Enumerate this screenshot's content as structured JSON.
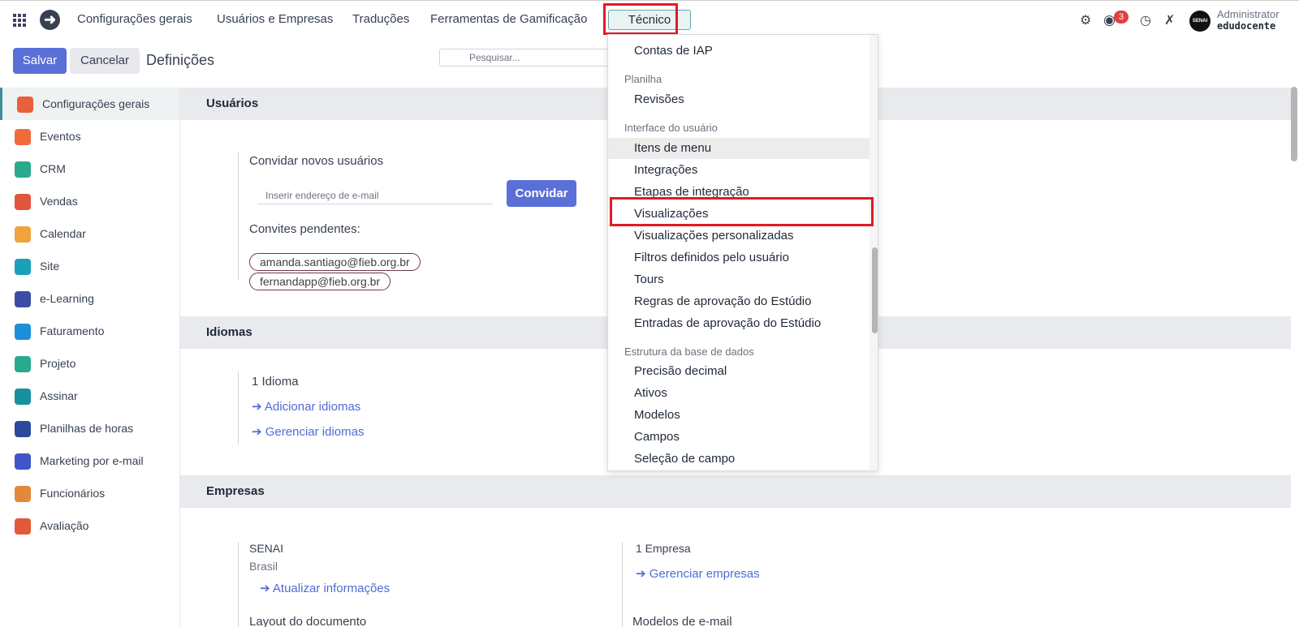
{
  "navbar": {
    "menu": [
      "Configurações gerais",
      "Usuários e Empresas",
      "Traduções",
      "Ferramentas de Gamificação"
    ],
    "active_menu": "Técnico",
    "notification_count": "3",
    "user": "Administrator",
    "database": "edudocente",
    "avatar_text": "SENAI"
  },
  "control": {
    "save": "Salvar",
    "cancel": "Cancelar",
    "title": "Definições",
    "search_placeholder": "Pesquisar..."
  },
  "sidebar": {
    "items": [
      {
        "label": "Configurações gerais",
        "icon": "settings-app-icon",
        "color": "#e8603c"
      },
      {
        "label": "Eventos",
        "icon": "events-app-icon",
        "color": "#f06b3c"
      },
      {
        "label": "CRM",
        "icon": "crm-app-icon",
        "color": "#2aa98e"
      },
      {
        "label": "Vendas",
        "icon": "sales-app-icon",
        "color": "#e1563c"
      },
      {
        "label": "Calendar",
        "icon": "calendar-app-icon",
        "color": "#f0a23c"
      },
      {
        "label": "Site",
        "icon": "website-app-icon",
        "color": "#1aa1b9"
      },
      {
        "label": "e-Learning",
        "icon": "elearning-app-icon",
        "color": "#3d4da3"
      },
      {
        "label": "Faturamento",
        "icon": "invoicing-app-icon",
        "color": "#1d8fd8"
      },
      {
        "label": "Projeto",
        "icon": "project-app-icon",
        "color": "#2aa98e"
      },
      {
        "label": "Assinar",
        "icon": "sign-app-icon",
        "color": "#1a8f9e"
      },
      {
        "label": "Planilhas de horas",
        "icon": "timesheets-app-icon",
        "color": "#2a4a9c"
      },
      {
        "label": "Marketing por e-mail",
        "icon": "email-marketing-app-icon",
        "color": "#3f56c8"
      },
      {
        "label": "Funcionários",
        "icon": "employees-app-icon",
        "color": "#e4883c"
      },
      {
        "label": "Avaliação",
        "icon": "appraisal-app-icon",
        "color": "#e4583c"
      }
    ]
  },
  "users": {
    "header": "Usuários",
    "invite_label": "Convidar novos usuários",
    "email_placeholder": "Inserir endereço de e-mail",
    "invite_button": "Convidar",
    "pending_label": "Convites pendentes:",
    "pending": [
      "amanda.santiago@fieb.org.br",
      "fernandapp@fieb.org.br"
    ]
  },
  "languages": {
    "header": "Idiomas",
    "count": "1 Idioma",
    "add": "Adicionar idiomas",
    "manage": "Gerenciar idiomas"
  },
  "companies": {
    "header": "Empresas",
    "company_name": "SENAI",
    "country": "Brasil",
    "update": "Atualizar informações",
    "count": "1 Empresa",
    "manage": "Gerenciar empresas",
    "doc_layout": "Layout do documento",
    "email_templates": "Modelos de e-mail"
  },
  "dropdown": {
    "iap": "Contas de IAP",
    "sheet_header": "Planilha",
    "revisions": "Revisões",
    "ui_header": "Interface do usuário",
    "ui_items": [
      "Itens de menu",
      "Integrações",
      "Etapas de integração",
      "Visualizações",
      "Visualizações personalizadas",
      "Filtros definidos pelo usuário",
      "Tours",
      "Regras de aprovação do Estúdio",
      "Entradas de aprovação do Estúdio"
    ],
    "db_header": "Estrutura da base de dados",
    "db_items": [
      "Precisão decimal",
      "Ativos",
      "Modelos",
      "Campos",
      "Seleção de campo"
    ]
  },
  "colors": {
    "primary": "#5b6fd8",
    "highlight": "#e01b24",
    "accent": "#3f8f9a"
  }
}
